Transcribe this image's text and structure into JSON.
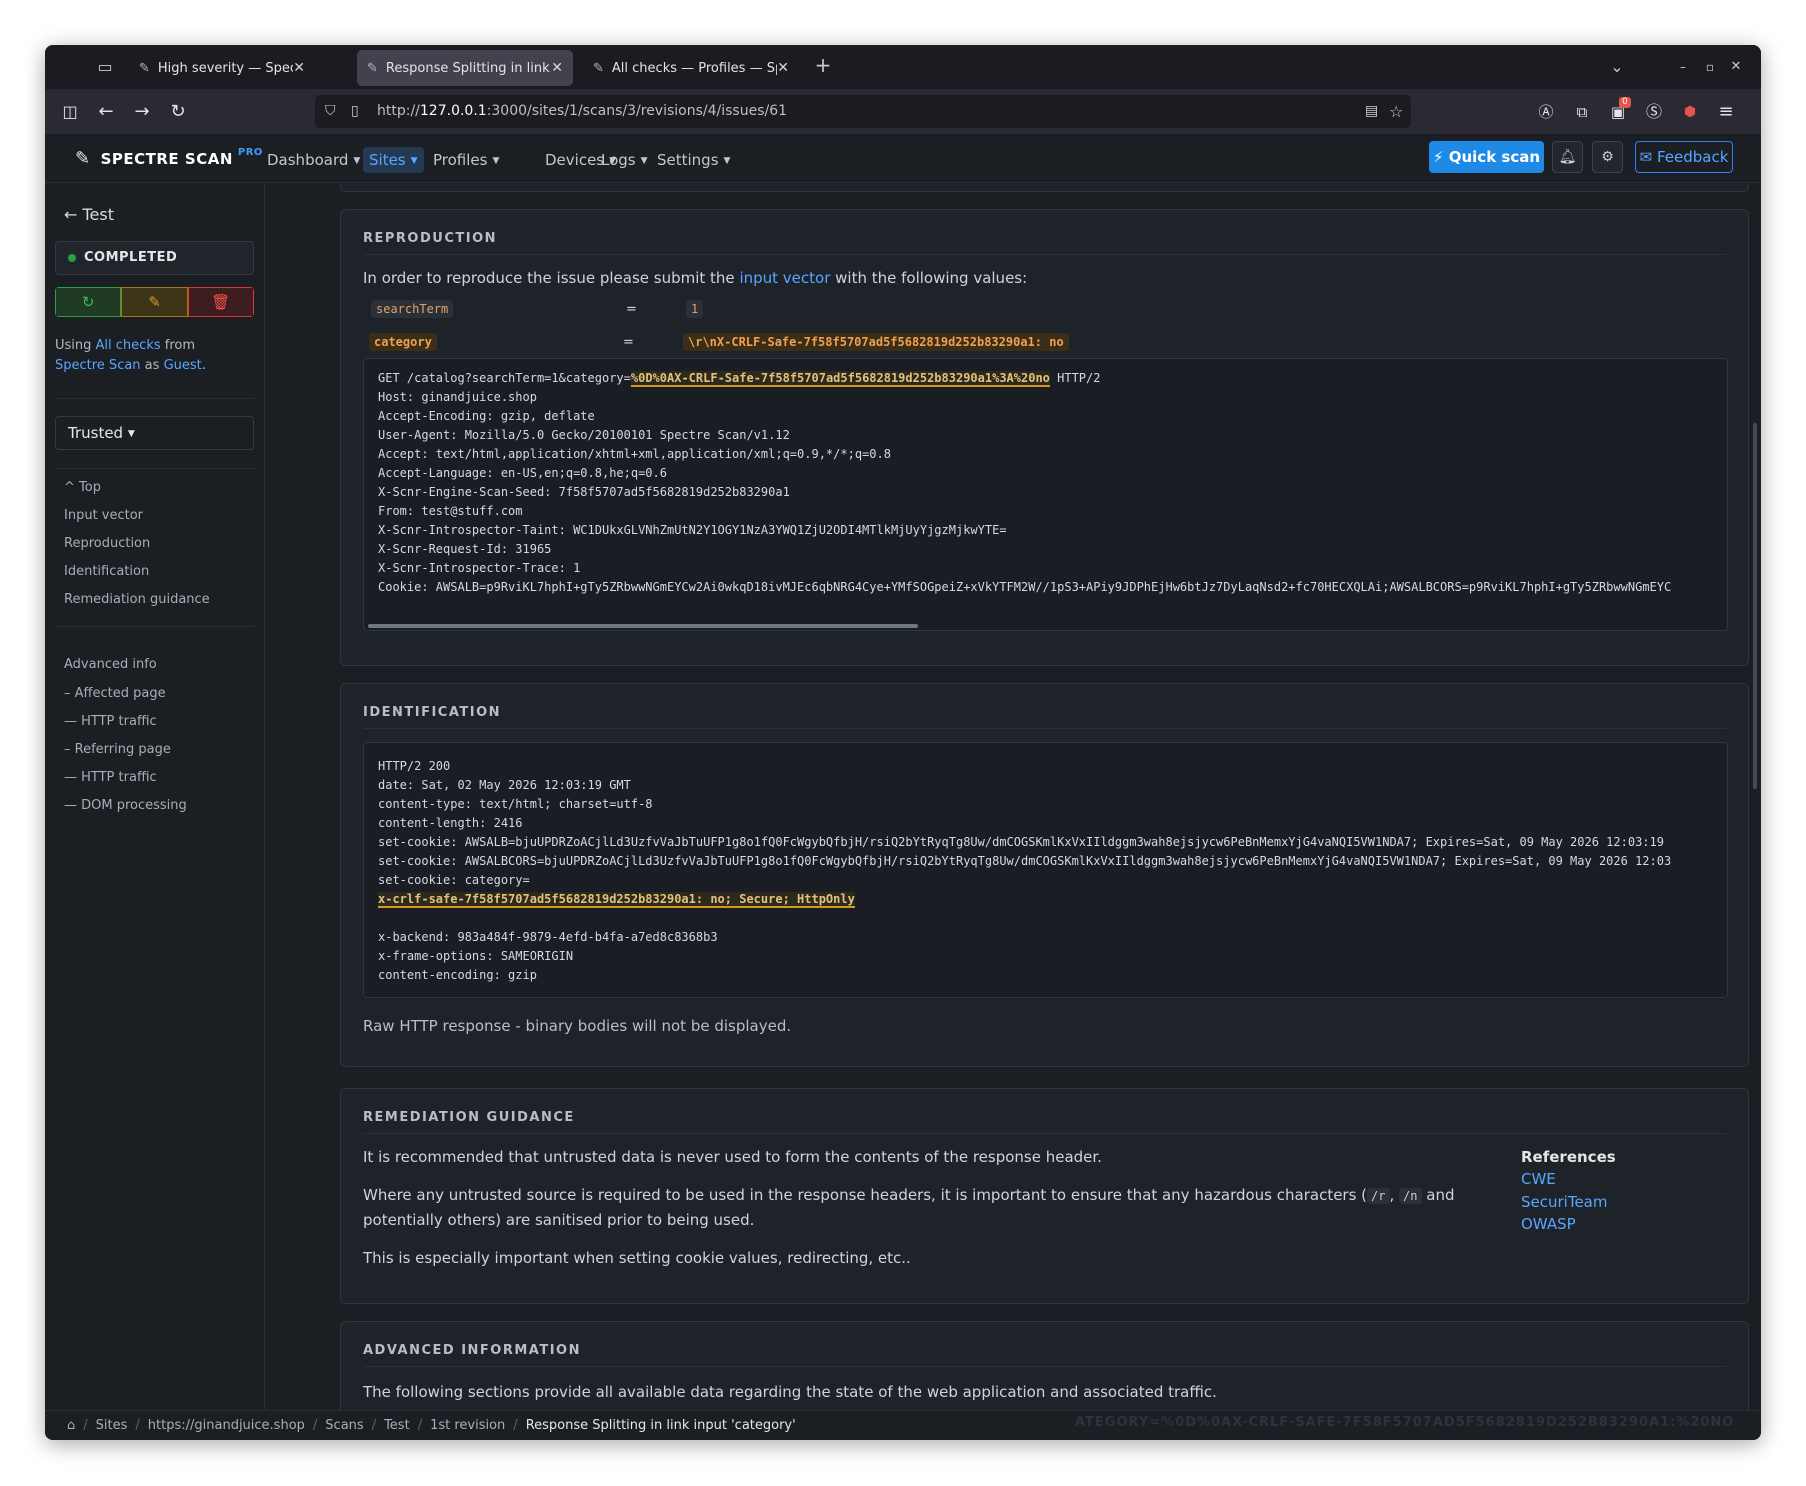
{
  "browser": {
    "tabs": [
      {
        "title": "High severity — Spectre Scan",
        "active": false
      },
      {
        "title": "Response Splitting in link input",
        "active": true
      },
      {
        "title": "All checks — Profiles — Spectre",
        "active": false
      }
    ],
    "new_tab": "+",
    "url_prefix": "http://",
    "url_host": "127.0.0.1",
    "url_path": ":3000/sites/1/scans/3/revisions/4/issues/61",
    "notification_count": "0"
  },
  "app": {
    "brand": "SPECTRE SCAN",
    "brand_tag": "PRO",
    "menu": [
      {
        "label": "Dashboard",
        "active": false
      },
      {
        "label": "Sites",
        "active": true
      },
      {
        "label": "Profiles",
        "active": false
      },
      {
        "label": "Devices",
        "active": false
      },
      {
        "label": "Logs",
        "active": false
      },
      {
        "label": "Settings",
        "active": false
      }
    ],
    "quick_scan": "Quick scan",
    "feedback": "Feedback"
  },
  "sidebar": {
    "back": "Test",
    "status": "COMPLETED",
    "using_prefix": "Using ",
    "using_profile": "All checks",
    "using_from": " from ",
    "using_device": "Spectre Scan",
    "using_as": " as ",
    "using_user": "Guest",
    "using_end": ".",
    "trust": "Trusted",
    "nav": [
      "Top",
      "Input vector",
      "Reproduction",
      "Identification",
      "Remediation guidance"
    ],
    "advanced": [
      "Advanced info",
      "– Affected page",
      "— HTTP traffic",
      "– Referring page",
      "— HTTP traffic",
      "— DOM processing"
    ]
  },
  "reproduction": {
    "heading": "REPRODUCTION",
    "intro_before": "In order to reproduce the issue please submit the ",
    "intro_link": "input vector",
    "intro_after": " with the following values:",
    "params": [
      {
        "name": "searchTerm",
        "eq": "=",
        "value": "1"
      },
      {
        "name": "category",
        "eq": "=",
        "value": "\\r\\nX-CRLF-Safe-7f58f5707ad5f5682819d252b83290a1: no"
      }
    ],
    "request_first_pre": "GET /catalog?searchTerm=1&category=",
    "request_first_hl": "%0D%0AX-CRLF-Safe-7f58f5707ad5f5682819d252b83290a1%3A%20no",
    "request_first_post": " HTTP/2",
    "request_lines": [
      "Host: ginandjuice.shop",
      "Accept-Encoding: gzip, deflate",
      "User-Agent: Mozilla/5.0 Gecko/20100101 Spectre Scan/v1.12",
      "Accept: text/html,application/xhtml+xml,application/xml;q=0.9,*/*;q=0.8",
      "Accept-Language: en-US,en;q=0.8,he;q=0.6",
      "X-Scnr-Engine-Scan-Seed: 7f58f5707ad5f5682819d252b83290a1",
      "From: test@stuff.com",
      "X-Scnr-Introspector-Taint: WC1DUkxGLVNhZmUtN2Y1OGY1NzA3YWQ1ZjU2ODI4MTlkMjUyYjgzMjkwYTE=",
      "X-Scnr-Request-Id: 31965",
      "X-Scnr-Introspector-Trace: 1",
      "Cookie: AWSALB=p9RviKL7hphI+gTy5ZRbwwNGmEYCw2Ai0wkqD18ivMJEc6qbNRG4Cye+YMfSOGpeiZ+xVkYTFM2W//1pS3+APiy9JDPhEjHw6btJz7DyLaqNsd2+fc70HECXQLAi;AWSALBCORS=p9RviKL7hphI+gTy5ZRbwwNGmEYC"
    ]
  },
  "identification": {
    "heading": "IDENTIFICATION",
    "response_lines": [
      "HTTP/2 200",
      "date: Sat, 02 May 2026 12:03:19 GMT",
      "content-type: text/html; charset=utf-8",
      "content-length: 2416",
      "set-cookie: AWSALB=bjuUPDRZoACjlLd3UzfvVaJbTuUFP1g8o1fQ0FcWgybQfbjH/rsiQ2bYtRyqTg8Uw/dmCOGSKmlKxVxIIldggm3wah8ejsjycw6PeBnMemxYjG4vaNQI5VW1NDA7; Expires=Sat, 09 May 2026 12:03:19",
      "set-cookie: AWSALBCORS=bjuUPDRZoACjlLd3UzfvVaJbTuUFP1g8o1fQ0FcWgybQfbjH/rsiQ2bYtRyqTg8Uw/dmCOGSKmlKxVxIIldggm3wah8ejsjycw6PeBnMemxYjG4vaNQI5VW1NDA7; Expires=Sat, 09 May 2026 12:03",
      "set-cookie: category="
    ],
    "response_hl": "x-crlf-safe-7f58f5707ad5f5682819d252b83290a1: no; Secure; HttpOnly",
    "response_tail": [
      "x-backend: 983a484f-9879-4efd-b4fa-a7ed8c8368b3",
      "x-frame-options: SAMEORIGIN",
      "content-encoding: gzip"
    ],
    "note": "Raw HTTP response - binary bodies will not be displayed."
  },
  "remediation": {
    "heading": "REMEDIATION GUIDANCE",
    "p1": "It is recommended that untrusted data is never used to form the contents of the response header.",
    "p2_before": "Where any untrusted source is required to be used in the response headers, it is important to ensure that any hazardous characters (",
    "p2_code1": "/r",
    "p2_mid": ", ",
    "p2_code2": "/n",
    "p2_after": " and potentially others) are sanitised prior to being used.",
    "p3": "This is especially important when setting cookie values, redirecting, etc..",
    "refs_title": "References",
    "refs": [
      "CWE",
      "SecuriTeam",
      "OWASP"
    ]
  },
  "advanced": {
    "heading": "ADVANCED INFORMATION",
    "p1": "The following sections provide all available data regarding the state of the web application and associated traffic."
  },
  "breadcrumb": [
    "Sites",
    "https://ginandjuice.shop",
    "Scans",
    "Test",
    "1st revision",
    "Response Splitting in link input 'category'"
  ],
  "breadcrumb_ghost": "ATEGORY=%0D%0AX-CRLF-SAFE-7F58F5707AD5F5682819D252B83290A1:%20NO"
}
